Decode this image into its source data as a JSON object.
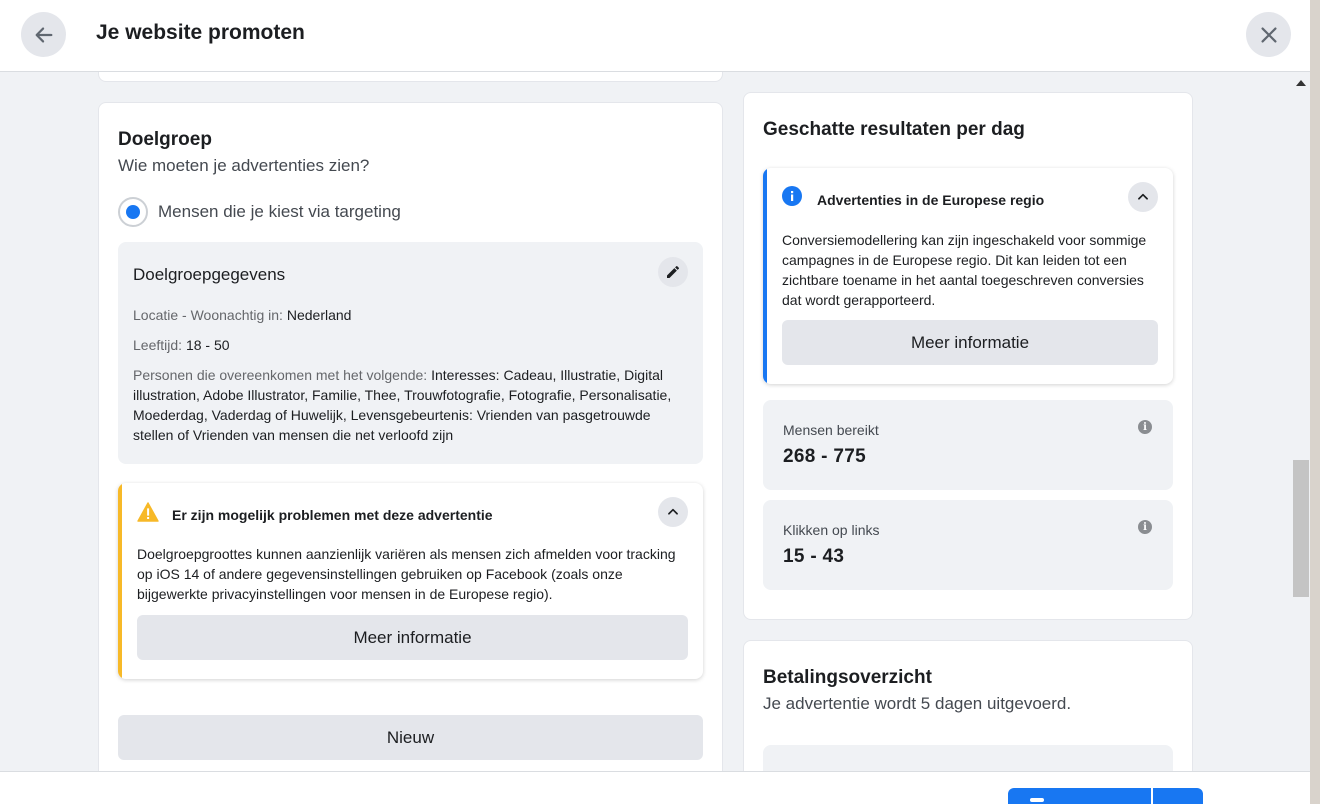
{
  "header": {
    "title": "Je website promoten",
    "back_icon": "arrow-left-icon",
    "close_icon": "close-icon"
  },
  "audience": {
    "title": "Doelgroep",
    "question": "Wie moeten je advertenties zien?",
    "option_label": "Mensen die je kiest via targeting",
    "details": {
      "title": "Doelgroepgegevens",
      "location_label": "Locatie - Woonachtig in:",
      "location_value": "Nederland",
      "age_label": "Leeftijd:",
      "age_value": "18 - 50",
      "interests_label": "Personen die overeenkomen met het volgende:",
      "interests_value": "Interesses: Cadeau, Illustratie, Digital illustration, Adobe Illustrator, Familie, Thee, Trouwfotografie, Fotografie, Personalisatie, Moederdag, Vaderdag of Huwelijk, Levensgebeurtenis: Vrienden van pasgetrouwde stellen of Vrienden van mensen die net verloofd zijn"
    },
    "warning": {
      "title": "Er zijn mogelijk problemen met deze advertentie",
      "text": "Doelgroepgroottes kunnen aanzienlijk variëren als mensen zich afmelden voor tracking op iOS 14 of andere gegevensinstellingen gebruiken op Facebook (zoals onze bijgewerkte privacyinstellingen voor mensen in de Europese regio).",
      "button": "Meer informatie"
    },
    "new_button": "Nieuw"
  },
  "results": {
    "title": "Geschatte resultaten per dag",
    "info": {
      "title": "Advertenties in de Europese regio",
      "text": "Conversiemodellering kan zijn ingeschakeld voor sommige campagnes in de Europese regio. Dit kan leiden tot een zichtbare toename in het aantal toegeschreven conversies dat wordt gerapporteerd.",
      "button": "Meer informatie"
    },
    "reach_label": "Mensen bereikt",
    "reach_value": "268 - 775",
    "clicks_label": "Klikken op links",
    "clicks_value": "15 - 43"
  },
  "payment": {
    "title": "Betalingsoverzicht",
    "subtitle": "Je advertentie wordt 5 dagen uitgevoerd."
  },
  "colors": {
    "accent": "#1877f2",
    "warning": "#f7b928",
    "background": "#f0f2f5"
  }
}
